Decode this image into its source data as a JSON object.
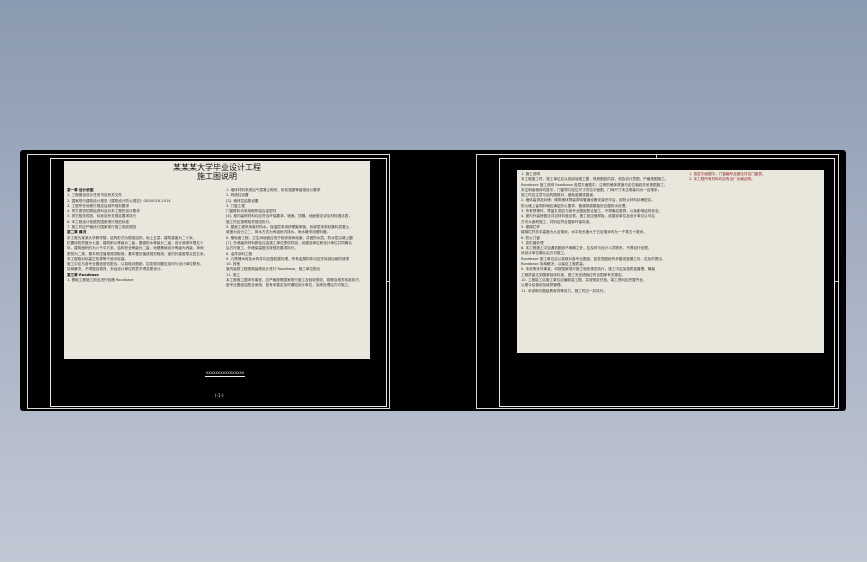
{
  "canvas": {
    "background": "#000000",
    "border_color": "#d8d8d8",
    "app_background_top": "#8a9aaf",
    "app_background_bottom": "#c1c7d3"
  },
  "left_document": {
    "title_line1": "某某某大学毕业设计工程",
    "title_line2": "施工图说明",
    "caption": "XXXXXXXXXXXXXXXX",
    "page_number": "(-1-)",
    "col1": [
      {
        "text": "第一章 设计依据",
        "style": "heading"
      },
      {
        "text": "1. 工程建设设计任务书及有关文件"
      },
      {
        "text": "2. 国家现行建筑设计规范《建筑设计防火规范》GB50016-2014"
      },
      {
        "text": "3. 工程所在地现行规定及城市规划要求"
      },
      {
        "text": "4. 甲方提供的原始资料及对本工程的设计要求"
      },
      {
        "text": "5. 其它相关规范、标准及有关规定要求执行"
      },
      {
        "text": "6. 本工程设计依据的国家现行规范标准"
      },
      {
        "text": "7. 施工时应严格执行国家现行施工验收规范"
      },
      {
        "text": "第二章 概况",
        "style": "heading"
      },
      {
        "text": "  本工程为某某大学教学楼，结构形式为框架结构，地上五层，建筑高度为二十米，"
      },
      {
        "text": "抗震设防烈度为七度，建筑耐火等级为二级，屋面防水等级为二级，设计使用年限五十"
      },
      {
        "text": "年，建筑面积约为六千平方米，结构安全等级为二级，地基基础设计等级为丙级，场地"
      },
      {
        "text": "类别为二类，基本风压值按规范取用，基本雪压值按规范取用，室内外高差零点四五米，"
      },
      {
        "text": "本工程相对标高正负零等于绝对标高。"
      },
      {
        "text": "  施工中应与各专业图纸密切配合，认真核对图纸，如发现问题应及时与设计单位联系，"
      },
      {
        "text": "协商解决，不得擅自更改，未经设计单位同意不得变更设计。"
      },
      {
        "text": "第三章 Roadbase",
        "style": "heading"
      },
      {
        "text": "  1. 基础工程施工前应进行验槽 Roadbase"
      }
    ],
    "col2": [
      {
        "text": "1. 墙体材料采用加气混凝土砌块，砂浆强度等级按设计要求"
      },
      {
        "text": "2. 构造柱设置"
      },
      {
        "text": "[3]. 墙体拉结筋设置"
      },
      {
        "text": "3. 门窗工程"
      },
      {
        "text": "  门窗框料均采用断桥铝合金型材"
      },
      {
        "text": "  [4]. 室内装修材料均应符合环保要求，墙面、顶棚、地面做法详见材料做法表，"
      },
      {
        "text": "施工时应按照相关规范执行。"
      },
      {
        "text": "  5. 屋面工程采用卷材防水，保温层采用挤塑聚苯板，找坡层采用轻集料混凝土，"
      },
      {
        "text": "坡度为百分之二，排水方式为有组织内排水，雨水管采用塑料管。"
      },
      {
        "text": "  6. 楼地面工程，卫生间地面应低于相邻房间地面，并做防水层，防水层沿墙上翻"
      },
      {
        "text": "  [7]. 外墙装饰材料颜色应由施工单位提供样品，经建设单位和设计单位共同确认"
      },
      {
        "text": "后方可施工，外墙保温做法按规范要求执行。"
      },
      {
        "text": "  8. 油漆涂料工程"
      },
      {
        "text": "  9. 凡预埋木砖及木构件均应做防腐处理，所有金属构件均应先除锈后刷防锈漆"
      },
      {
        "text": "  10. 其他"
      },
      {
        "text": "  室内装修工程按照装修设计进行 Roadbase，施工单位配合"
      },
      {
        "text": "  11. 施工"
      },
      {
        "text": "  本工程施工图未尽事宜，应严格按照国家现行施工及验收规范、规程及相关标准执行，"
      },
      {
        "text": "各专业图纸应配合使用，如有矛盾应及时通知设计单位，协商处理后方可施工。"
      }
    ]
  },
  "right_document": {
    "col1": [
      {
        "text": "  1. 施工说明"
      },
      {
        "text": "  本工程施工时，施工单位应认真阅读施工图，熟悉图纸内容，领会设计意图，严格按图施工。"
      },
      {
        "text": "Roadbase 施工说明 Roadbase 各层平面图中，注明的墙体厚度与定位轴线关系按图施工，"
      },
      {
        "text": "未注明者墙体均居中，门窗洞口定位尺寸详见平面图，门垛尺寸未注明者均为一百毫米，"
      },
      {
        "text": "施工时应注意与结构图核对，避免遗漏或错误。"
      },
      {
        "text": "  2. 墙体留洞及封堵：砌筑墙体预留洞待管道设备安装完毕后，用防火材料封堵密实，"
      },
      {
        "text": "防火墙上留洞封堵应满足防火要求，管道穿越楼板处应做防水处理。"
      },
      {
        "text": "  3. 所有预埋件、预留孔洞应与各专业图纸配合施工，不得事后凿洞，以免影响结构安全。"
      },
      {
        "text": "  4. 室内外装修做法详见材料做法表，施工前应做样板，经建设单位及设计单位认可后"
      },
      {
        "text": "方可大面积施工，材料应符合国家环保标准。"
      },
      {
        "text": "  5. 楼梯栏杆"
      },
      {
        "text": "  楼梯栏杆扶手高度为九百毫米，水平段长度大于五百毫米时为一千零五十毫米。"
      },
      {
        "text": "  6. 防火门窗"
      },
      {
        "text": "  7. 变形缝处理"
      },
      {
        "text": "  8. 本工程施工中如遇到图纸不明确之处，应及时与设计人员联系，不得自行处理，"
      },
      {
        "text": "待设计单位确认后方可施工。"
      },
      {
        "text": "  Roadbase 施工单位应认真核对各专业图纸，如发现图纸有矛盾或遗漏之处，应及时提出，"
      },
      {
        "text": "Roadbase 协商解决，以保证工程质量。"
      },
      {
        "text": "  9. 本说明未尽事宜，均按国家现行施工验收规范执行，施工中应加强质量管理，确保"
      },
      {
        "text": "工程质量达到国家验收标准，施工安全措施应符合国家有关规定。"
      },
      {
        "text": "  10. 工程竣工后施工单位应编制竣工图，并按规定归档，竣工资料应完整齐全，"
      },
      {
        "text": "以便今后使用及维修管理。"
      },
      {
        "text": "  11. 本说明与图纸具有同等效力，施工时应一并执行。"
      }
    ],
    "col2": [
      {
        "text": "  1. 各层平面图中，门窗编号及做法详见门窗表。",
        "style": "red"
      },
      {
        "text": "  2. 本工程所有材料均应有出厂合格证明。",
        "style": "red"
      }
    ]
  }
}
